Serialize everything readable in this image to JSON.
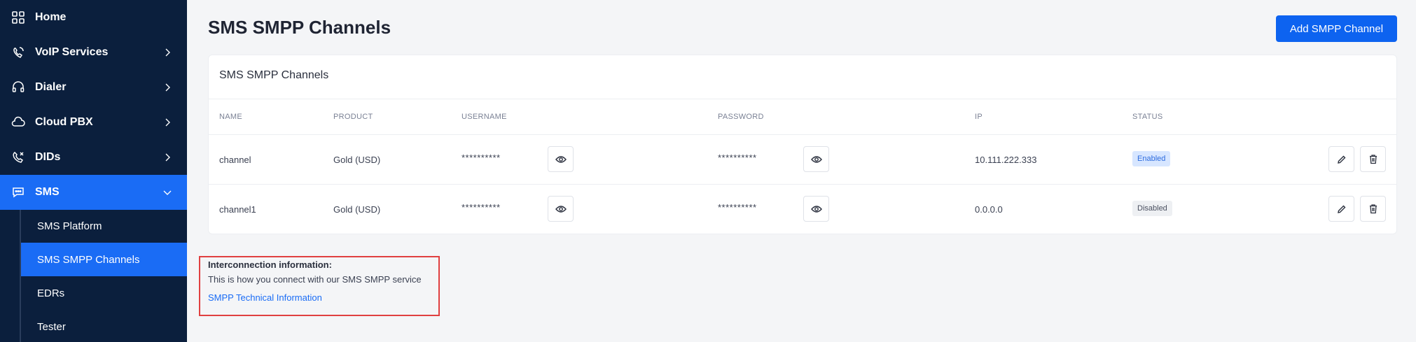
{
  "sidebar": {
    "items": [
      {
        "label": "Home",
        "icon": "grid-icon"
      },
      {
        "label": "VoIP Services",
        "icon": "voip-icon"
      },
      {
        "label": "Dialer",
        "icon": "headset-icon"
      },
      {
        "label": "Cloud PBX",
        "icon": "cloud-phone-icon"
      },
      {
        "label": "DIDs",
        "icon": "phone-icon"
      },
      {
        "label": "SMS",
        "icon": "sms-icon"
      }
    ],
    "sms_sub": [
      {
        "label": "SMS Platform"
      },
      {
        "label": "SMS SMPP Channels"
      },
      {
        "label": "EDRs"
      },
      {
        "label": "Tester"
      }
    ]
  },
  "header": {
    "title": "SMS SMPP Channels",
    "add_label": "Add SMPP Channel"
  },
  "card": {
    "title": "SMS SMPP Channels",
    "columns": [
      "NAME",
      "PRODUCT",
      "USERNAME",
      "PASSWORD",
      "IP",
      "STATUS"
    ],
    "rows": [
      {
        "name": "channel",
        "product": "Gold (USD)",
        "username": "**********",
        "password": "**********",
        "ip": "10.111.222.333",
        "status": "Enabled"
      },
      {
        "name": "channel1",
        "product": "Gold (USD)",
        "username": "**********",
        "password": "**********",
        "ip": "0.0.0.0",
        "status": "Disabled"
      }
    ]
  },
  "info": {
    "title": "Interconnection information:",
    "text": "This is how you connect with our SMS SMPP service",
    "link": "SMPP Technical Information"
  },
  "colors": {
    "sidebar_bg": "#0b1f3d",
    "accent": "#1a6cf5",
    "highlight_border": "#e04040"
  }
}
